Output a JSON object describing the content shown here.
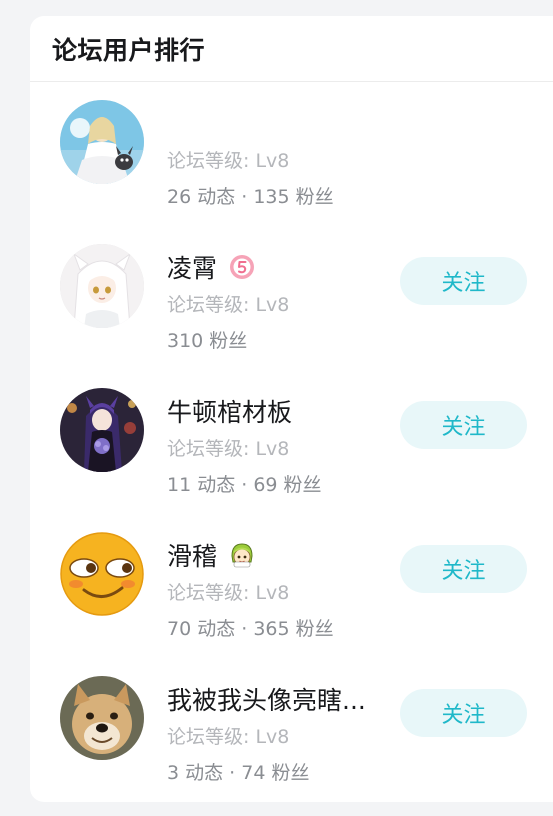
{
  "panel": {
    "title": "论坛用户排行"
  },
  "users": [
    {
      "name": "",
      "level": "论坛等级: Lv8",
      "stats": "26 动态 · 135 粉丝",
      "follow_label": "",
      "avatar_icon": "anime-girl-white-dress-avatar"
    },
    {
      "name": "凌霄",
      "level": "论坛等级: Lv8",
      "stats": "310 粉丝",
      "follow_label": "关注",
      "badge_icon": "pink-number-5-badge",
      "avatar_icon": "white-haired-anime-girl-avatar"
    },
    {
      "name": "牛顿棺材板",
      "level": "论坛等级: Lv8",
      "stats": "11 动态 · 69 粉丝",
      "follow_label": "关注",
      "avatar_icon": "purple-haired-anime-girl-avatar"
    },
    {
      "name": "滑稽",
      "level": "论坛等级: Lv8",
      "stats": "70 动态 · 365 粉丝",
      "follow_label": "关注",
      "badge_icon": "green-haired-girl-emoji-badge",
      "avatar_icon": "funny-smirk-emoji-avatar"
    },
    {
      "name": "我被我头像亮瞎...",
      "level": "论坛等级: Lv8",
      "stats": "3 动态 · 74 粉丝",
      "follow_label": "关注",
      "avatar_icon": "doge-dog-avatar"
    }
  ],
  "colors": {
    "accent": "#1fb8c9",
    "follow_bg": "#e8f7f9",
    "level_text": "#b4b6ba",
    "stats_text": "#8a8d92",
    "name_text": "#18191c"
  }
}
